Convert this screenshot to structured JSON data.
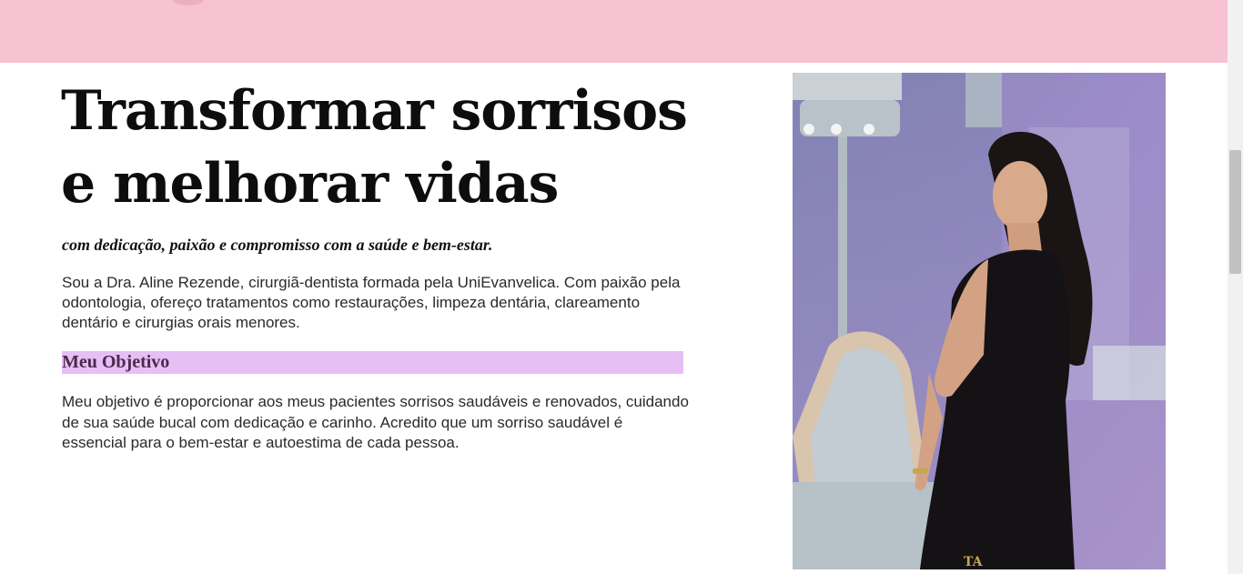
{
  "hero": {
    "headline_line1": "Transformar sorrisos",
    "headline_line2": "e melhorar vidas",
    "subtitle": "com dedicação, paixão e compromisso com a saúde e bem-estar.",
    "intro": "Sou a Dra. Aline Rezende, cirurgiã-dentista formada pela UniEvanvelica. Com paixão pela odontologia, ofereço tratamentos como restaurações, limpeza dentária, clareamento dentário e cirurgias orais menores."
  },
  "objective": {
    "heading": "Meu Objetivo",
    "text": "Meu objetivo é proporcionar aos meus pacientes sorrisos saudáveis e renovados, cuidando de sua saúde bucal com dedicação e carinho. Acredito que um sorriso saudável é essencial para o bem-estar e autoestima de cada pessoa."
  },
  "colors": {
    "banner": "#f7c3d3",
    "highlight": "#e6bff5"
  },
  "photo": {
    "description_icon": "dentist-portrait-image",
    "watermark": "TA"
  }
}
